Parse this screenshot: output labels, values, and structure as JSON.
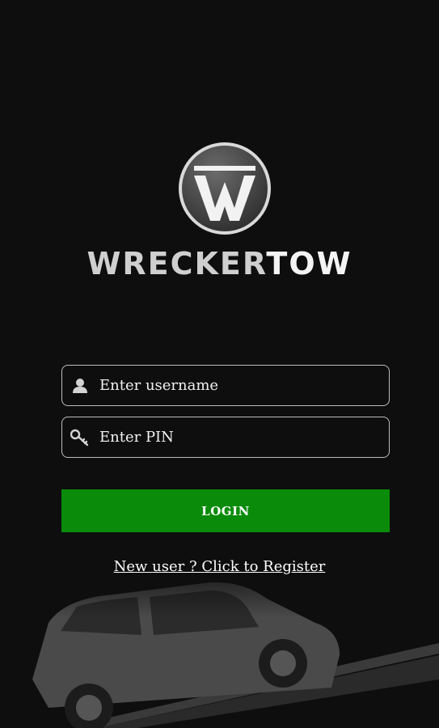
{
  "brand": {
    "part1": "WRECKER",
    "part2": "TOW"
  },
  "form": {
    "username_placeholder": "Enter username",
    "pin_placeholder": "Enter PIN",
    "login_label": "LOGIN",
    "register_link": "New user ? Click to Register"
  },
  "icons": {
    "user": "user-icon",
    "key": "key-icon",
    "logo": "logo-w-icon"
  },
  "colors": {
    "background": "#0e0e0f",
    "login_button": "#0a8c0a",
    "field_border": "#bdbdbd"
  }
}
